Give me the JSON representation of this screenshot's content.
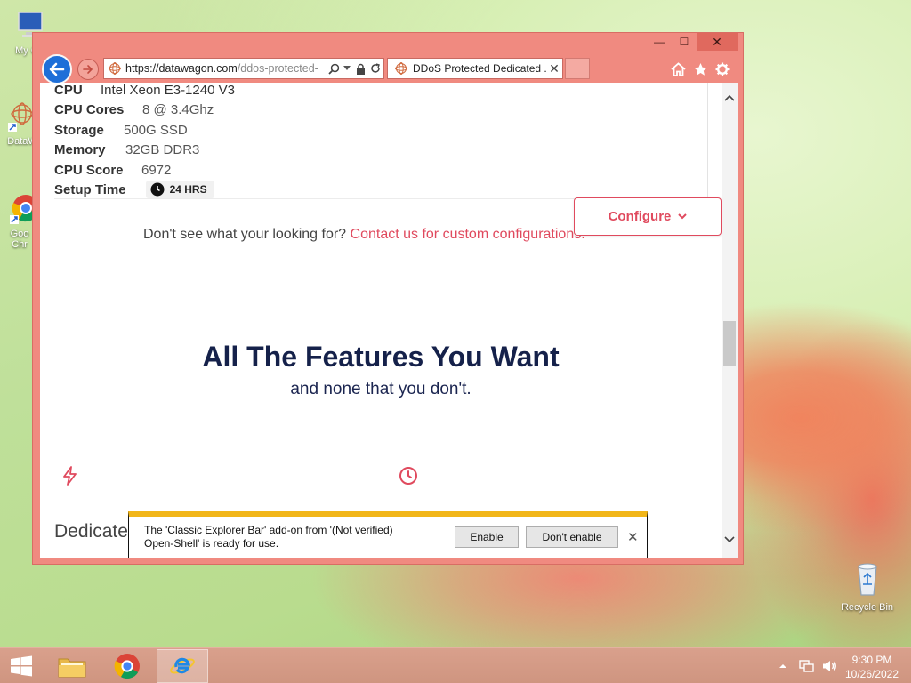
{
  "desktop": {
    "icons": [
      {
        "label": "My Co",
        "name": "my-computer-icon"
      },
      {
        "label": "DataW",
        "name": "datawagon-icon"
      },
      {
        "label": "Goo Chr",
        "name": "google-chrome-icon"
      },
      {
        "label": "Recycle Bin",
        "name": "recycle-bin-icon"
      }
    ]
  },
  "window": {
    "controls": {
      "minimize": "—",
      "maximize": "☐",
      "close": "✕"
    }
  },
  "address_bar": {
    "url_main": "https://datawagon.com",
    "url_rest": "/ddos-protected-"
  },
  "tab": {
    "label": "DDoS Protected Dedicated ...",
    "close": "✕"
  },
  "specs": [
    {
      "key": "CPU",
      "value": "Intel Xeon E3-1240 V3"
    },
    {
      "key": "CPU Cores",
      "value": "8 @ 3.4Ghz"
    },
    {
      "key": "Storage",
      "value": "500G SSD"
    },
    {
      "key": "Memory",
      "value": "32GB DDR3"
    },
    {
      "key": "CPU Score",
      "value": "6972"
    },
    {
      "key": "Setup Time",
      "value": "24 HRS"
    }
  ],
  "configure": {
    "label": "Configure",
    "chevron": "⌄"
  },
  "lookingfor": {
    "text": "Don't see what your looking for?",
    "link": "Contact us for custom configurations."
  },
  "features": {
    "title": "All The Features You Want",
    "subtitle": "and none that you don't."
  },
  "dedicated_heading": "Dedicate",
  "notification": {
    "message_line1": "The 'Classic Explorer Bar' add-on from '(Not verified)",
    "message_line2": "Open-Shell' is ready for use.",
    "enable": "Enable",
    "dont_enable": "Don't enable",
    "close": "✕"
  },
  "taskbar": {
    "time": "9:30 PM",
    "date": "10/26/2022"
  },
  "colors": {
    "accent": "#e04a5e",
    "heading": "#15214a",
    "window_frame": "#f08a80",
    "notification_bar": "#f2b619"
  }
}
